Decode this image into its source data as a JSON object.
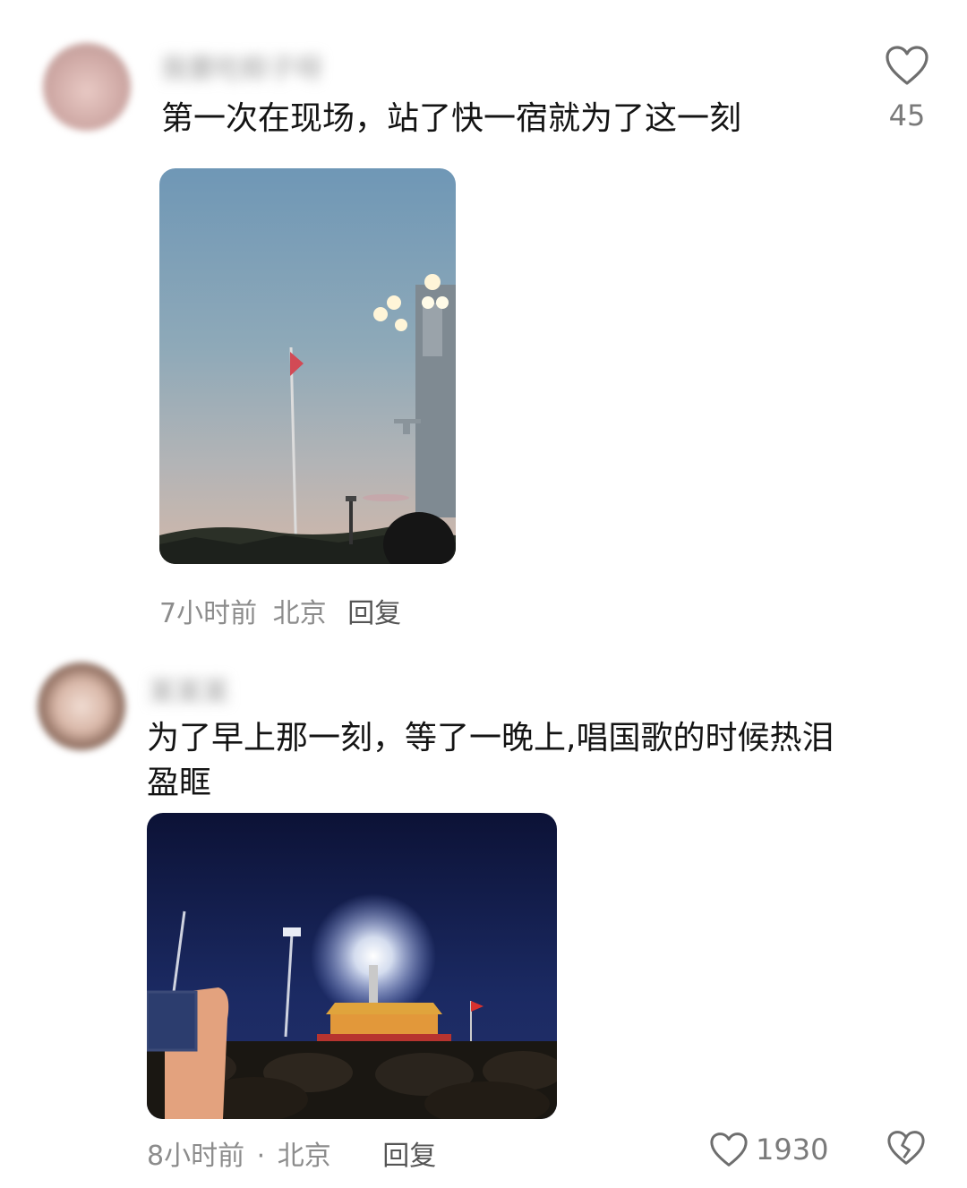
{
  "comments": [
    {
      "username": "我要吃粽子呀",
      "text": "第一次在现场，站了快一宿就为了这一刻",
      "photo_icon": "flag-photo",
      "time": "7小时前",
      "location": "北京",
      "reply_label": "回复",
      "like_icon": "heart-icon",
      "like_count": "45"
    },
    {
      "username": "某某某",
      "text_line1": "为了早上那一刻，等了一晚上,唱国歌的时候热泪",
      "text_line2": "盈眶",
      "photo_icon": "tiananmen-night-photo",
      "time": "8小时前",
      "sep": "·",
      "location": "北京",
      "reply_label": "回复",
      "like_icon": "heart-icon",
      "like_count": "1930",
      "dislike_icon": "broken-heart-icon"
    }
  ],
  "colors": {
    "text": "#141414",
    "meta": "#8c8c8c",
    "icon": "#6e6e6e"
  }
}
